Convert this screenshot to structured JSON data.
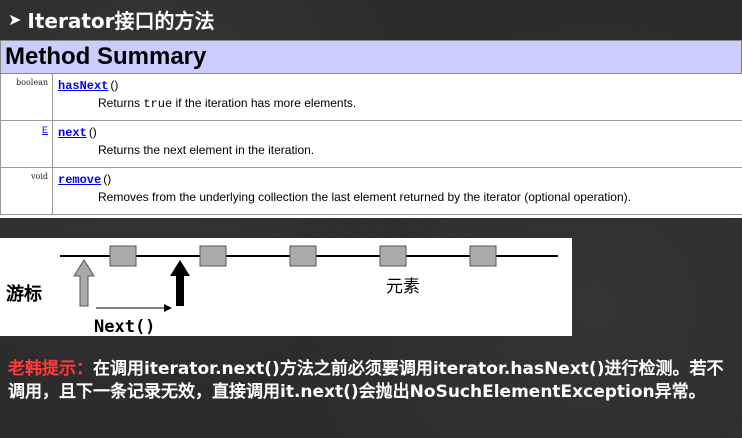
{
  "slide": {
    "title": "Iterator接口的方法"
  },
  "summary": {
    "header": "Method Summary",
    "rows": [
      {
        "modifier": "boolean",
        "name": "hasNext",
        "parens": "()",
        "desc_prefix": "Returns ",
        "desc_code": "true",
        "desc_suffix": " if the iteration has more elements."
      },
      {
        "modifier": "E",
        "name": "next",
        "parens": "()",
        "desc_prefix": "Returns the next element in the iteration.",
        "desc_code": "",
        "desc_suffix": ""
      },
      {
        "modifier": "void",
        "name": "remove",
        "parens": "()",
        "desc_prefix": "Removes from the underlying collection the last element returned by the iterator (optional operation).",
        "desc_code": "",
        "desc_suffix": ""
      }
    ]
  },
  "diagram": {
    "cursor_label": "游标",
    "element_label": "元素",
    "next_label": "Next()"
  },
  "note": {
    "highlight": "老韩提示：",
    "text": "在调用iterator.next()方法之前必须要调用iterator.hasNext()进行检测。若不调用，且下一条记录无效，直接调用it.next()会抛出NoSuchElementException异常。"
  },
  "colors": {
    "summary_header_bg": "#ccccff",
    "link": "#0000ee",
    "highlight": "#ff3b3b"
  }
}
